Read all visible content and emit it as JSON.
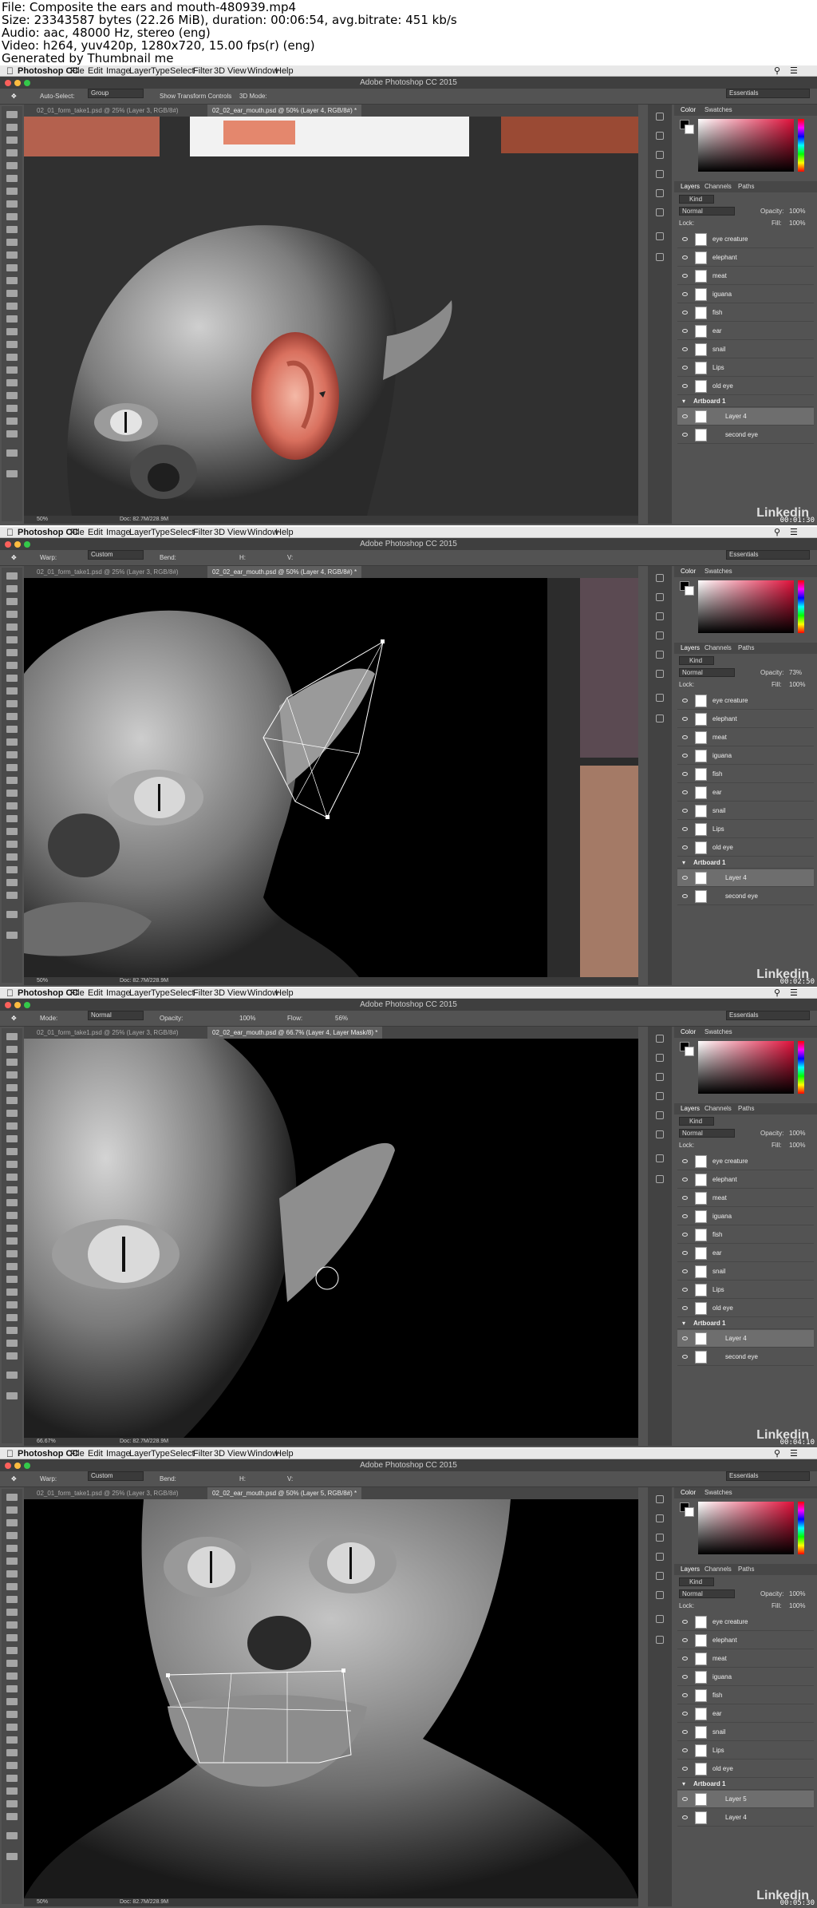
{
  "header": {
    "line1": "File: Composite the ears and mouth-480939.mp4",
    "line2": "Size: 23343587 bytes (22.26 MiB), duration: 00:06:54, avg.bitrate: 451 kb/s",
    "line3": "Audio: aac, 48000 Hz, stereo (eng)",
    "line4": "Video: h264, yuv420p, 1280x720, 15.00 fps(r) (eng)",
    "line5": "Generated by Thumbnail me"
  },
  "menu": {
    "app": "Photoshop CC",
    "file": "File",
    "edit": "Edit",
    "image": "Image",
    "layer": "Layer",
    "type": "Type",
    "select": "Select",
    "filter": "Filter",
    "three_d": "3D",
    "view": "View",
    "window": "Window",
    "help": "Help"
  },
  "window_title": "Adobe Photoshop CC 2015",
  "essentials": "Essentials",
  "colors": {
    "accent": "#e0103a",
    "panel": "#535353",
    "titlebar": "#3f3f3f"
  },
  "panel": {
    "color": "Color",
    "swatches": "Swatches",
    "layers": "Layers",
    "channels": "Channels",
    "paths": "Paths",
    "kind": "Kind",
    "blend": "Normal",
    "opacity_label": "Opacity:",
    "fill_label": "Fill:",
    "fill": "100%",
    "lock": "Lock:",
    "layer_names": [
      "eye creature",
      "elephant",
      "meat",
      "iguana",
      "fish",
      "ear",
      "snail",
      "Lips",
      "old eye"
    ],
    "artboard": "Artboard 1"
  },
  "frames": [
    {
      "options": {
        "a": "Auto-Select:",
        "b": "Group",
        "c": "Show Transform Controls",
        "d": "3D Mode:"
      },
      "tabs": [
        "02_01_form_take1.psd @ 25% (Layer 3, RGB/8#)",
        "02_02_ear_mouth.psd @ 50% (Layer 4, RGB/8#) *"
      ],
      "opacity": "100%",
      "sel1": "Layer 4",
      "sel2": "second eye",
      "zoom": "50%",
      "doc": "Doc: 82.7M/228.9M",
      "time": "00:01:30"
    },
    {
      "options": {
        "a": "Warp:",
        "b": "Custom",
        "c": "Bend:",
        "d": "H:",
        "e": "V:"
      },
      "tabs": [
        "02_01_form_take1.psd @ 25% (Layer 3, RGB/8#)",
        "02_02_ear_mouth.psd @ 50% (Layer 4, RGB/8#) *"
      ],
      "opacity": "73%",
      "sel1": "Layer 4",
      "sel2": "second eye",
      "zoom": "50%",
      "doc": "Doc: 82.7M/228.9M",
      "time": "00:02:50"
    },
    {
      "options": {
        "a": "Mode:",
        "b": "Normal",
        "c": "Opacity:",
        "d": "100%",
        "e": "Flow:",
        "f": "56%"
      },
      "tabs": [
        "02_01_form_take1.psd @ 25% (Layer 3, RGB/8#)",
        "02_02_ear_mouth.psd @ 66.7% (Layer 4, Layer Mask/8) *"
      ],
      "opacity": "100%",
      "sel1": "Layer 4",
      "sel2": "second eye",
      "zoom": "66.67%",
      "doc": "Doc: 82.7M/228.9M",
      "time": "00:04:10"
    },
    {
      "options": {
        "a": "Warp:",
        "b": "Custom",
        "c": "Bend:",
        "d": "H:",
        "e": "V:"
      },
      "tabs": [
        "02_01_form_take1.psd @ 25% (Layer 3, RGB/8#)",
        "02_02_ear_mouth.psd @ 50% (Layer 5, RGB/8#) *"
      ],
      "opacity": "100%",
      "sel1": "Layer 5",
      "sel2": "Layer 4",
      "zoom": "50%",
      "doc": "Doc: 82.7M/228.9M",
      "time": "00:05:30"
    }
  ],
  "watermark": "Linkedin"
}
